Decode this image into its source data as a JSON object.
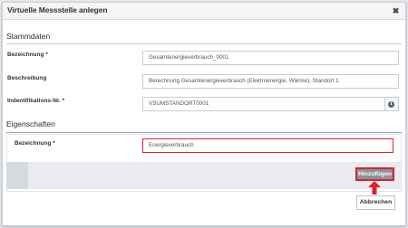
{
  "dialog": {
    "title": "Virtuelle Messstelle anlegen",
    "close_glyph": "✖"
  },
  "stammdaten": {
    "section_title": "Stammdaten",
    "bezeichnung": {
      "label": "Bezeichnung *",
      "value": "Gesamtenergieverbrauch_0001"
    },
    "beschreibung": {
      "label": "Beschreibung",
      "value": "Berechnung Gesamtenergieverbrauch (Elektroenergie, Wärme), Standort 1"
    },
    "identifikation": {
      "label": "Indentifikations-Nr. *",
      "value": "VSUMSTANDORT0001",
      "info_glyph": "i"
    }
  },
  "eigenschaften": {
    "section_title": "Eigenschaften",
    "bezeichnung": {
      "label": "Bezeichnung *",
      "value": "Energieverbrauch"
    }
  },
  "buttons": {
    "add_label": "Hinzufügen",
    "cancel_label": "Abbrechen"
  },
  "colors": {
    "highlight": "#d9232d",
    "add_button": "#8a929b"
  }
}
